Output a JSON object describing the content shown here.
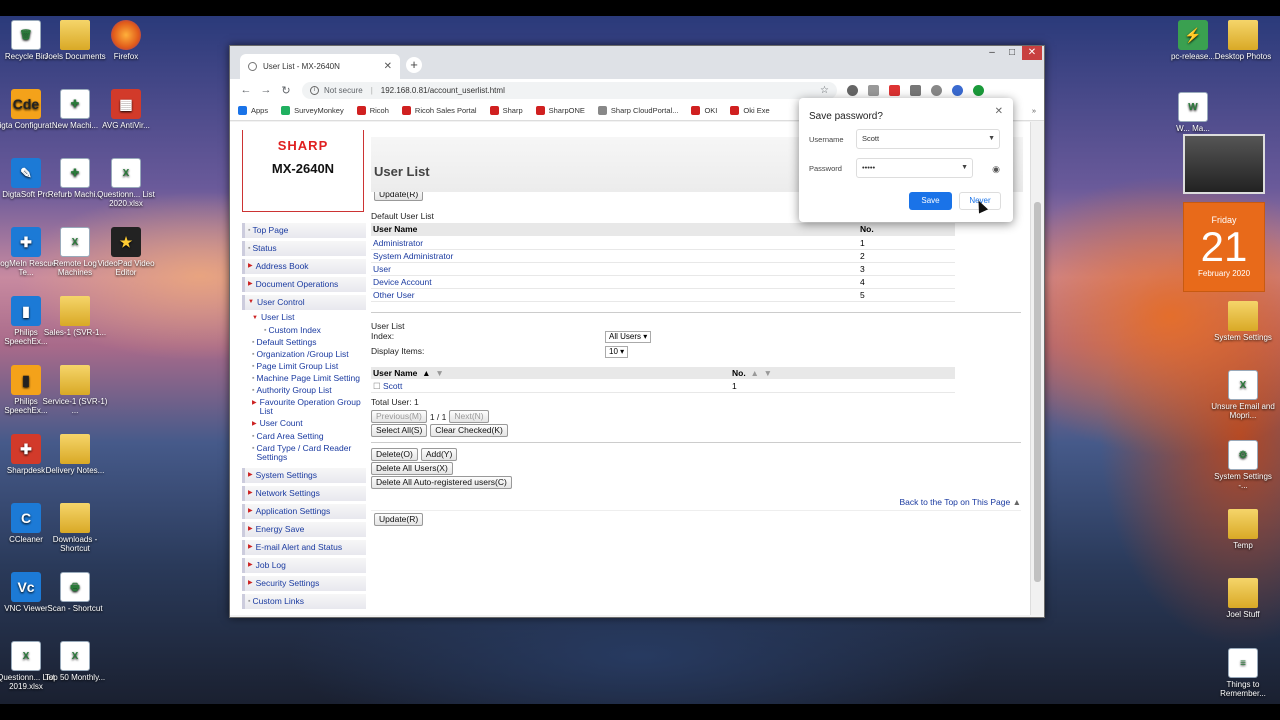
{
  "desktop": {
    "left_icons": [
      {
        "label": "Recycle Bin",
        "icon": "recycle-bin-icon",
        "style": "doc",
        "glyph": "🗑"
      },
      {
        "label": "Joels Documents",
        "icon": "folder-icon",
        "style": "folder",
        "glyph": ""
      },
      {
        "label": "Firefox",
        "icon": "firefox-icon",
        "style": "app-fire",
        "glyph": ""
      },
      {
        "label": "Digta Configurat...",
        "icon": "digta-icon",
        "style": "app-orange",
        "glyph": "Cde"
      },
      {
        "label": "New Machi...",
        "icon": "pdf-icon",
        "style": "doc",
        "glyph": "✚"
      },
      {
        "label": "AVG AntiVir...",
        "icon": "avg-icon",
        "style": "app-red",
        "glyph": "▦"
      },
      {
        "label": "DigtaSoft Pro",
        "icon": "digtasoft-icon",
        "style": "app-blue",
        "glyph": "✎"
      },
      {
        "label": "Refurb Machi...",
        "icon": "pdf-icon",
        "style": "doc",
        "glyph": "✚"
      },
      {
        "label": "Questionn... List 2020.xlsx",
        "icon": "excel-icon",
        "style": "doc",
        "glyph": "X"
      },
      {
        "label": "LogMeIn Rescue Te...",
        "icon": "logmein-icon",
        "style": "app-blue",
        "glyph": "✚"
      },
      {
        "label": "Remote Log Machines",
        "icon": "excel-icon",
        "style": "doc",
        "glyph": "X"
      },
      {
        "label": "VideoPad Video Editor",
        "icon": "videopad-icon",
        "style": "app-dark",
        "glyph": "★"
      },
      {
        "label": "Philips SpeechEx...",
        "icon": "philips-icon",
        "style": "app-blue",
        "glyph": "▮"
      },
      {
        "label": "Sales-1 (SVR-1...",
        "icon": "folder-icon",
        "style": "folder",
        "glyph": ""
      },
      {
        "label": "Philips SpeechEx...",
        "icon": "philips-icon",
        "style": "app-orange",
        "glyph": "▮"
      },
      {
        "label": "Service-1 (SVR-1) ...",
        "icon": "folder-icon",
        "style": "folder",
        "glyph": ""
      },
      {
        "label": "Sharpdesk",
        "icon": "sharpdesk-icon",
        "style": "app-red",
        "glyph": "✚"
      },
      {
        "label": "Delivery Notes...",
        "icon": "folder-icon",
        "style": "folder",
        "glyph": ""
      },
      {
        "label": "CCleaner",
        "icon": "ccleaner-icon",
        "style": "app-blue",
        "glyph": "C"
      },
      {
        "label": "Downloads - Shortcut",
        "icon": "folder-icon",
        "style": "folder",
        "glyph": ""
      },
      {
        "label": "VNC Viewer",
        "icon": "vnc-icon",
        "style": "app-blue",
        "glyph": "Vc"
      },
      {
        "label": "Scan - Shortcut",
        "icon": "folder-icon",
        "style": "doc",
        "glyph": "🖶"
      },
      {
        "label": "Questionn... List 2019.xlsx",
        "icon": "excel-icon",
        "style": "doc",
        "glyph": "X"
      },
      {
        "label": "Top 50 Monthly...",
        "icon": "excel-icon",
        "style": "doc",
        "glyph": "X"
      }
    ],
    "right_icons": [
      {
        "label": "pc-release...",
        "icon": "pc-release-icon",
        "style": "app-green",
        "glyph": "⚡"
      },
      {
        "label": "Desktop Photos",
        "icon": "folder-icon",
        "style": "folder",
        "glyph": ""
      },
      {
        "label": "W... Ma...",
        "icon": "document-icon",
        "style": "doc",
        "glyph": "W"
      },
      {
        "label": "System Settings",
        "icon": "folder-icon",
        "style": "folder",
        "glyph": ""
      },
      {
        "label": "Unsure Email and Mopri...",
        "icon": "excel-icon",
        "style": "doc",
        "glyph": "X"
      },
      {
        "label": "System Settings -...",
        "icon": "settings-icon",
        "style": "doc",
        "glyph": "⚙"
      },
      {
        "label": "Temp",
        "icon": "folder-icon",
        "style": "folder",
        "glyph": ""
      },
      {
        "label": "Joel Stuff",
        "icon": "folder-icon",
        "style": "folder",
        "glyph": ""
      },
      {
        "label": "Things to Remember...",
        "icon": "document-icon",
        "style": "doc",
        "glyph": "≡"
      }
    ],
    "calendar": {
      "day": "Friday",
      "date": "21",
      "month": "February 2020"
    }
  },
  "browser": {
    "tab_title": "User List - MX-2640N",
    "not_secure": "Not secure",
    "url": "192.168.0.81/account_userlist.html",
    "bookmarks": [
      {
        "label": "Apps",
        "icon": "apps-grid-icon",
        "color": "#1a73e8"
      },
      {
        "label": "SurveyMonkey",
        "icon": "surveymonkey-icon",
        "color": "#20b060"
      },
      {
        "label": "Ricoh",
        "icon": "ricoh-icon",
        "color": "#d02020"
      },
      {
        "label": "Ricoh Sales Portal",
        "icon": "ricoh-icon",
        "color": "#d02020"
      },
      {
        "label": "Sharp",
        "icon": "sharp-icon",
        "color": "#d02020"
      },
      {
        "label": "SharpONE",
        "icon": "sharp-icon",
        "color": "#d02020"
      },
      {
        "label": "Sharp CloudPortal...",
        "icon": "cloud-portal-icon",
        "color": "#888888"
      },
      {
        "label": "OKI",
        "icon": "oki-icon",
        "color": "#d02020"
      },
      {
        "label": "Oki Exe",
        "icon": "oki-icon",
        "color": "#d02020"
      }
    ]
  },
  "page": {
    "brand": "SHARP",
    "model": "MX-2640N",
    "title": "User List",
    "update_button": "Update(R)",
    "nav": [
      {
        "label": "Top Page",
        "kind": "box"
      },
      {
        "label": "Status",
        "kind": "box"
      },
      {
        "label": "Address Book",
        "kind": "arrow"
      },
      {
        "label": "Document Operations",
        "kind": "arrow"
      },
      {
        "label": "User Control",
        "kind": "arrow-down"
      }
    ],
    "user_control_sub": [
      {
        "label": "User List",
        "kind": "arrow-down",
        "level": 1
      },
      {
        "label": "Custom Index",
        "kind": "box",
        "level": 2
      },
      {
        "label": "Default Settings",
        "kind": "box",
        "level": 1
      },
      {
        "label": "Organization /Group List",
        "kind": "box",
        "level": 1
      },
      {
        "label": "Page Limit Group List",
        "kind": "box",
        "level": 1
      },
      {
        "label": "Machine Page Limit Setting",
        "kind": "box",
        "level": 1
      },
      {
        "label": "Authority Group List",
        "kind": "box",
        "level": 1
      },
      {
        "label": "Favourite Operation Group List",
        "kind": "arrow",
        "level": 1
      },
      {
        "label": "User Count",
        "kind": "arrow",
        "level": 1
      },
      {
        "label": "Card Area Setting",
        "kind": "box",
        "level": 1
      },
      {
        "label": "Card Type / Card Reader Settings",
        "kind": "box",
        "level": 1
      }
    ],
    "nav_bottom": [
      {
        "label": "System Settings",
        "kind": "arrow"
      },
      {
        "label": "Network Settings",
        "kind": "arrow"
      },
      {
        "label": "Application Settings",
        "kind": "arrow"
      },
      {
        "label": "Energy Save",
        "kind": "arrow"
      },
      {
        "label": "E-mail Alert and Status",
        "kind": "arrow"
      },
      {
        "label": "Job Log",
        "kind": "arrow"
      },
      {
        "label": "Security Settings",
        "kind": "arrow"
      },
      {
        "label": "Custom Links",
        "kind": "box"
      }
    ],
    "default_list": {
      "caption": "Default User List",
      "col_name": "User Name",
      "col_no": "No.",
      "rows": [
        {
          "name": "Administrator",
          "no": "1"
        },
        {
          "name": "System Administrator",
          "no": "2"
        },
        {
          "name": "User",
          "no": "3"
        },
        {
          "name": "Device Account",
          "no": "4"
        },
        {
          "name": "Other User",
          "no": "5"
        }
      ]
    },
    "user_list": {
      "caption": "User List",
      "index_label": "Index:",
      "index_value": "All Users",
      "display_label": "Display Items:",
      "display_value": "10",
      "col_name": "User Name",
      "col_no": "No.",
      "rows": [
        {
          "name": "Scott",
          "no": "1"
        }
      ],
      "total_label": "Total User:",
      "total_value": "1",
      "prev": "Previous(M)",
      "page": "1 / 1",
      "next": "Next(N)",
      "select_all": "Select All(S)",
      "clear_checked": "Clear Checked(K)",
      "delete": "Delete(O)",
      "add": "Add(Y)",
      "delete_all": "Delete All Users(X)",
      "delete_auto": "Delete All Auto-registered users(C)",
      "back_to_top": "Back to the Top on This Page"
    }
  },
  "password_popup": {
    "title": "Save password?",
    "username_label": "Username",
    "username_value": "Scott",
    "password_label": "Password",
    "password_value": "•••••",
    "save": "Save",
    "never": "Never"
  }
}
